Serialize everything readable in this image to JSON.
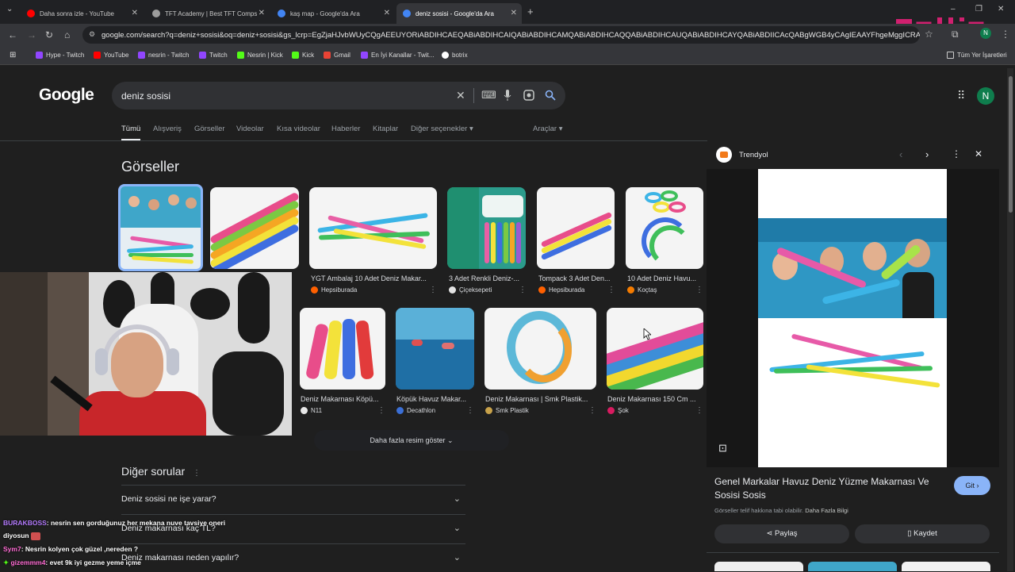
{
  "tabs": [
    {
      "title": "Daha sonra izle - YouTube",
      "color": "#ff0000"
    },
    {
      "title": "TFT Academy | Best TFT Comps",
      "color": "#9c9c9c"
    },
    {
      "title": "kaş map - Google'da Ara",
      "color": "#4285f4"
    },
    {
      "title": "deniz sosisi - Google'da Ara",
      "color": "#4285f4"
    }
  ],
  "address": {
    "url": "google.com/search?q=deniz+sosisi&oq=deniz+sosisi&gs_lcrp=EgZjaHJvbWUyCQgAEEUYORiABDIHCAEQABiABDIHCAIQABiABDIHCAMQABiABDIHCAQQABiABDIHCAUQABiABDIHCAYQABiABDIICAcQABgWGB4yCAgIEAAYFhgeMggICRAAGBYYHhjl"
  },
  "bookmarks": [
    {
      "label": "Hype - Twitch",
      "color": "#9146ff"
    },
    {
      "label": "YouTube",
      "color": "#ff0000"
    },
    {
      "label": "nesrin - Twitch",
      "color": "#9146ff"
    },
    {
      "label": "Twitch",
      "color": "#9146ff"
    },
    {
      "label": "Nesrin | Kick",
      "color": "#53fc18"
    },
    {
      "label": "Kick",
      "color": "#53fc18"
    },
    {
      "label": "Gmail",
      "color": "#ea4335"
    },
    {
      "label": "En İyi Kanallar - Twit...",
      "color": "#9146ff"
    },
    {
      "label": "botrix",
      "color": "#ffffff"
    }
  ],
  "bookmarks_right": "Tüm Yer İşaretleri",
  "google": {
    "logo": "Google",
    "query": "deniz sosisi",
    "avatar_letter": "N",
    "filter_tabs": [
      "Tümü",
      "Alışveriş",
      "Görseller",
      "Videolar",
      "Kısa videolar",
      "Haberler",
      "Kitaplar",
      "Diğer seçenekler"
    ],
    "tools": "Araçlar",
    "images_heading": "Görseller",
    "more_images": "Daha fazla resim göster",
    "questions_heading": "Diğer sorular",
    "questions": [
      "Deniz sosisi ne işe yarar?",
      "Deniz makarnası kaç TL?",
      "Deniz makarnası neden yapılır?"
    ]
  },
  "results_row1": [
    {
      "caption": "YGT Ambalaj 10 Adet Deniz Makar...",
      "source": "Hepsiburada",
      "src_color": "#ff6000"
    },
    {
      "caption": "3 Adet Renkli Deniz-...",
      "source": "Çiçeksepeti",
      "src_color": "#e3e3e3"
    },
    {
      "caption": "Tompack 3 Adet Den...",
      "source": "Hepsiburada",
      "src_color": "#ff6000"
    },
    {
      "caption": "10 Adet Deniz Havu...",
      "source": "Koçtaş",
      "src_color": "#f57c00"
    }
  ],
  "results_row2": [
    {
      "caption": "Deniz Makarnası Köpü...",
      "source": "N11",
      "src_color": "#e8e8e8"
    },
    {
      "caption": "Köpük Havuz Makar...",
      "source": "Decathlon",
      "src_color": "#3b6fd6"
    },
    {
      "caption": "Deniz Makarnası | Smk Plastik...",
      "source": "Smk Plastik",
      "src_color": "#c8a24a"
    },
    {
      "caption": "Deniz Makarnası 150 Cm ...",
      "source": "Şok",
      "src_color": "#d81b60"
    }
  ],
  "panel": {
    "source": "Trendyol",
    "title": "Genel Markalar Havuz Deniz Yüzme Makarnası Ve Sosisi Sosis",
    "go_button": "Git",
    "copyright": "Görseller telif hakkına tabi olabilir.",
    "learn_more": "Daha Fazla Bilgi",
    "share": "Paylaş",
    "save": "Kaydet"
  },
  "chat": [
    {
      "user": "BURAKBOSS",
      "color": "#b57cff",
      "text": ": nesrin sen gorduğunuz her mekana nuve tavsiye oneri"
    },
    {
      "user": "",
      "color": "#ffffff",
      "text": "diyosun"
    },
    {
      "user": "Sym7",
      "color": "#ff6cd4",
      "text": ": Nesrin kolyen çok güzel ,nereden ?"
    },
    {
      "user": "gizemmm4",
      "color": "#ff6cd4",
      "text": ": evet 9k iyi gezme yeme içme"
    }
  ],
  "colors": {
    "page_bg": "#1f1f1f",
    "search_bg": "#303134",
    "accent_blue": "#8ab4f8",
    "avatar": "#0f7d4d"
  }
}
